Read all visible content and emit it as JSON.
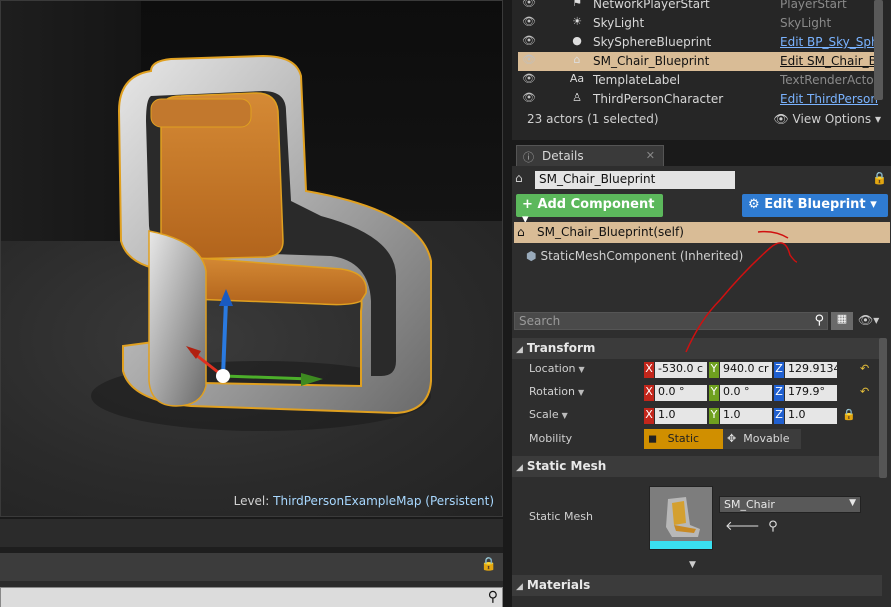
{
  "viewport": {
    "level_key": "Level:",
    "level_value": "ThirdPersonExampleMap (Persistent)"
  },
  "outliner": {
    "rows": [
      {
        "name": "NetworkPlayerStart",
        "type": "PlayerStart",
        "type_link": false,
        "selected": false,
        "icon": "player-start-icon"
      },
      {
        "name": "SkyLight",
        "type": "SkyLight",
        "type_link": false,
        "selected": false,
        "icon": "skylight-icon"
      },
      {
        "name": "SkySphereBlueprint",
        "type": "Edit BP_Sky_Sph",
        "type_link": true,
        "selected": false,
        "icon": "sphere-icon"
      },
      {
        "name": "SM_Chair_Blueprint",
        "type": "Edit SM_Chair_B",
        "type_link": true,
        "selected": true,
        "icon": "blueprint-icon"
      },
      {
        "name": "TemplateLabel",
        "type": "TextRenderActor",
        "type_link": false,
        "selected": false,
        "icon": "text-render-icon"
      },
      {
        "name": "ThirdPersonCharacter",
        "type": "Edit ThirdPerson",
        "type_link": true,
        "selected": false,
        "icon": "character-icon"
      }
    ],
    "count": "23 actors (1 selected)",
    "view_options": "View Options"
  },
  "details": {
    "tab_label": "Details",
    "actor_name": "SM_Chair_Blueprint",
    "add_component": "Add Component",
    "edit_blueprint": "Edit Blueprint",
    "component_self": "SM_Chair_Blueprint(self)",
    "component_mesh": "StaticMeshComponent (Inherited)",
    "search_placeholder": "Search",
    "transform": {
      "category": "Transform",
      "location_label": "Location",
      "rotation_label": "Rotation",
      "scale_label": "Scale",
      "mobility_label": "Mobility",
      "location": {
        "x": "-530.0 c",
        "y": "940.0 cr",
        "z": "129.9134"
      },
      "rotation": {
        "x": "0.0 °",
        "y": "0.0 °",
        "z": "179.9°"
      },
      "scale": {
        "x": "1.0",
        "y": "1.0",
        "z": "1.0"
      },
      "mobility_static": "Static",
      "mobility_movable": "Movable"
    },
    "static_mesh": {
      "category": "Static Mesh",
      "label": "Static Mesh",
      "value": "SM_Chair"
    },
    "materials": {
      "category": "Materials"
    }
  },
  "colors": {
    "selection": "#d9bc96",
    "add_component": "#5cb85c",
    "edit_blueprint": "#2f7bd1",
    "axis_x": "#c3261b",
    "axis_y": "#6fa01f",
    "axis_z": "#1f5fd0",
    "chair_leather": "#c97a2a",
    "annotation": "#d01010"
  }
}
